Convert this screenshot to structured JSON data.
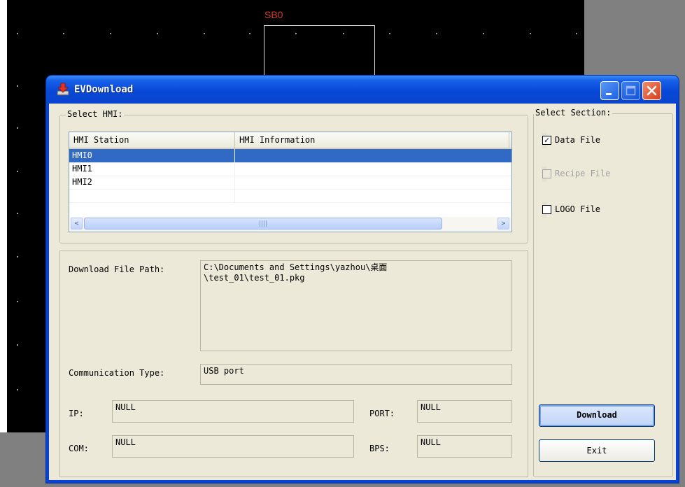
{
  "background": {
    "shape_label": "SB0"
  },
  "window": {
    "title": "EVDownload",
    "minimize_icon": "minimize-icon",
    "maximize_icon": "maximize-icon",
    "close_icon": "close-icon"
  },
  "select_hmi": {
    "group_title": "Select HMI:",
    "columns": [
      "HMI Station",
      "HMI Information"
    ],
    "rows": [
      {
        "station": "HMI0",
        "info": "",
        "selected": true
      },
      {
        "station": "HMI1",
        "info": "",
        "selected": false
      },
      {
        "station": "HMI2",
        "info": "",
        "selected": false
      }
    ],
    "scroll_left_glyph": "<",
    "scroll_right_glyph": ">",
    "scroll_thumb_glyph": "III"
  },
  "details": {
    "download_path_label": "Download File Path:",
    "download_path_value": "C:\\Documents and Settings\\yazhou\\桌面\n\\test_01\\test_01.pkg",
    "comm_type_label": "Communication Type:",
    "comm_type_value": "USB port",
    "ip_label": "IP:",
    "ip_value": "NULL",
    "port_label": "PORT:",
    "port_value": "NULL",
    "com_label": "COM:",
    "com_value": "NULL",
    "bps_label": "BPS:",
    "bps_value": "NULL"
  },
  "select_section": {
    "group_title": "Select Section:",
    "items": [
      {
        "label": "Data File",
        "checked": true,
        "enabled": true
      },
      {
        "label": "Recipe File",
        "checked": false,
        "enabled": false
      },
      {
        "label": "LOGO File",
        "checked": false,
        "enabled": true
      }
    ],
    "check_glyph": "✓"
  },
  "buttons": {
    "download": "Download",
    "exit": "Exit"
  },
  "colors": {
    "title_bar": "#0a48d4",
    "selection": "#316ac5",
    "dialog_face": "#ece9d8",
    "shape_label": "#d23c2a"
  }
}
